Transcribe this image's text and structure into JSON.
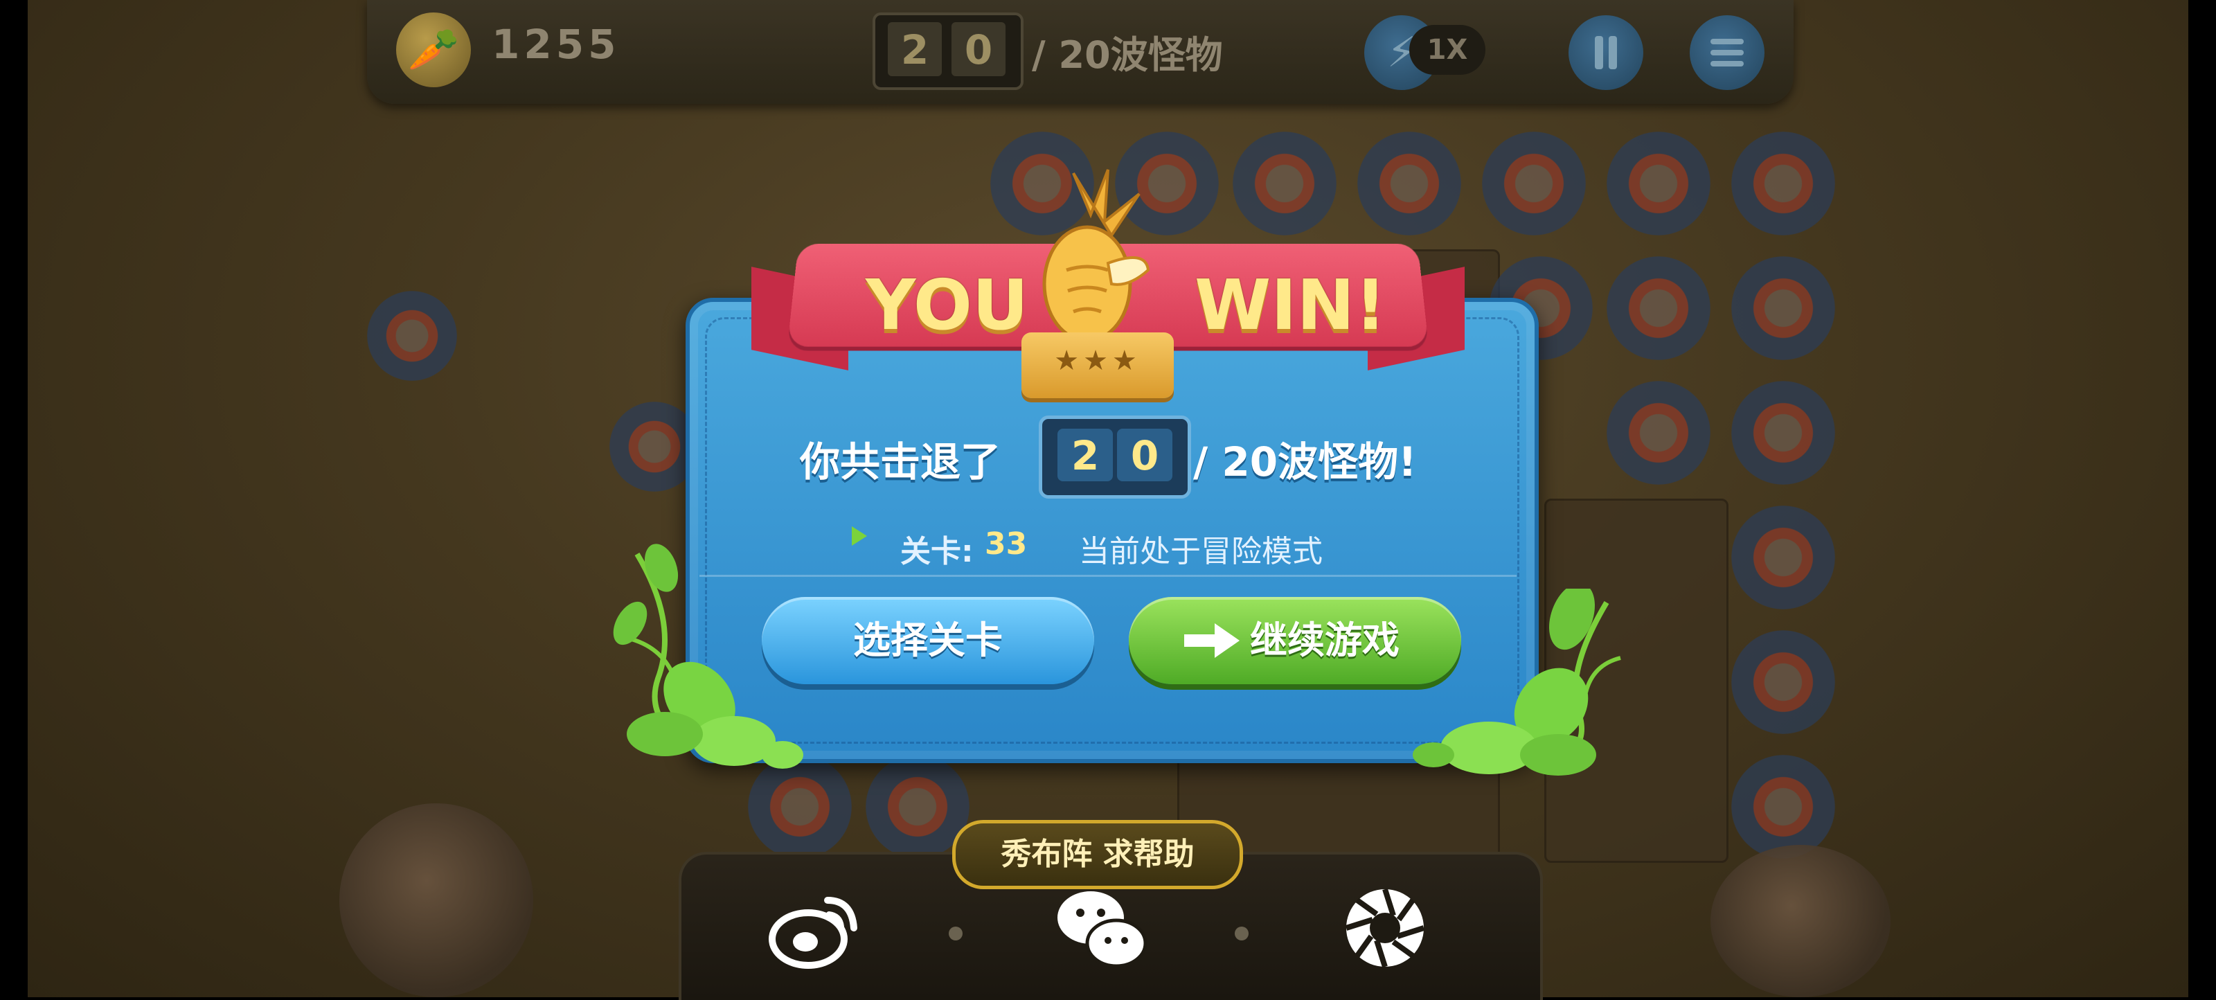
{
  "hud": {
    "gold": "1255",
    "wave_digits": [
      "2",
      "0"
    ],
    "wave_total": "/ 20波怪物",
    "speed": "1X",
    "icons": {
      "coin": "carrot-coin-icon",
      "speed": "lightning-icon",
      "pause": "pause-icon",
      "menu": "menu-icon"
    }
  },
  "result": {
    "title_left": "YOU",
    "title_right": "WIN!",
    "stars": "★★★",
    "message_prefix": "你共击退了",
    "count_digits": [
      "2",
      "0"
    ],
    "message_suffix": "/ 20波怪物!",
    "level_label": "关卡:",
    "level_number": "33",
    "mode_text": "当前处于冒险模式",
    "select_level_button": "选择关卡",
    "continue_button": "继续游戏"
  },
  "share": {
    "tag": "秀布阵 求帮助",
    "icons": [
      "weibo-icon",
      "wechat-icon",
      "camera-shutter-icon"
    ]
  },
  "colors": {
    "panel": "#3a9ad6",
    "ribbon": "#e44b64",
    "title_text": "#ffe98a",
    "button_blue": "#2a95dc",
    "button_green": "#4fab26",
    "share_border": "#d3a92c"
  }
}
